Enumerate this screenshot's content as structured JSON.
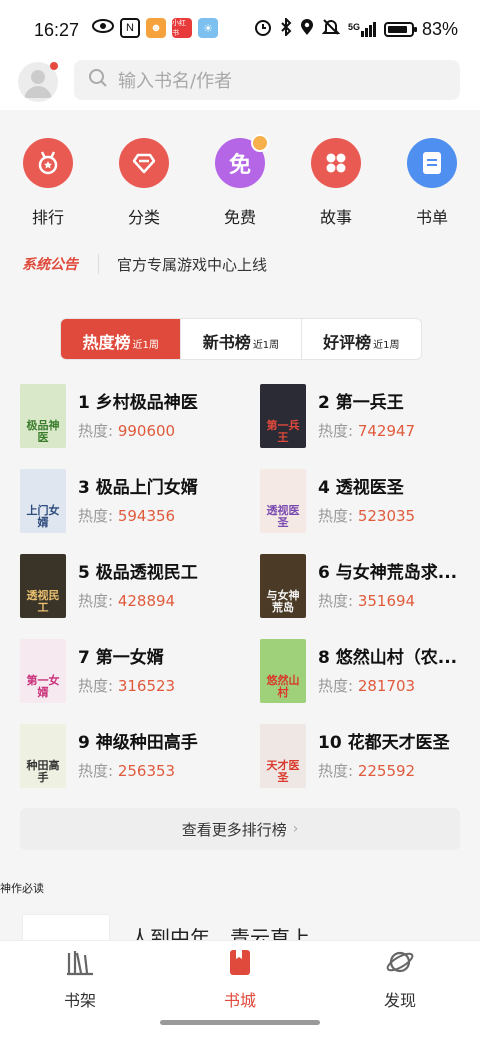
{
  "status_bar": {
    "time": "16:27",
    "left_icons": [
      "eye-icon",
      "nfc-icon",
      "app-icon-game",
      "app-icon-xiaohongshu",
      "app-icon-weather"
    ],
    "app_label": "小红书",
    "right_icons": [
      "alarm-icon",
      "bluetooth-icon",
      "location-icon",
      "mute-icon",
      "signal-5g-icon",
      "battery-icon"
    ],
    "network": "5G",
    "battery": "83%"
  },
  "header": {
    "search_placeholder": "输入书名/作者"
  },
  "categories": [
    {
      "label": "排行",
      "icon": "rank-medal-icon",
      "color": "#e95a52"
    },
    {
      "label": "分类",
      "icon": "category-diamond-icon",
      "color": "#e95a52"
    },
    {
      "label": "免费",
      "icon": "free-icon",
      "color": "#b466e6",
      "icon_text": "免"
    },
    {
      "label": "故事",
      "icon": "story-grid-icon",
      "color": "#e95a52"
    },
    {
      "label": "书单",
      "icon": "booklist-icon",
      "color": "#4f8ff0"
    }
  ],
  "notice": {
    "tag": "系统公告",
    "text": "官方专属游戏中心上线"
  },
  "tabs": [
    {
      "name": "热度榜",
      "sub": "近1周",
      "active": true
    },
    {
      "name": "新书榜",
      "sub": "近1周",
      "active": false
    },
    {
      "name": "好评榜",
      "sub": "近1周",
      "active": false
    }
  ],
  "books": [
    {
      "title": "1 乡村极品神医",
      "heat_label": "热度: ",
      "heat": "990600",
      "cover_text": "极品神医",
      "cover_bg": "#d9e8c8",
      "cover_fg": "#3a7d2c"
    },
    {
      "title": "2 第一兵王",
      "heat_label": "热度: ",
      "heat": "742947",
      "cover_text": "第一兵王",
      "cover_bg": "#2b2b35",
      "cover_fg": "#e04a3c"
    },
    {
      "title": "3 极品上门女婿",
      "heat_label": "热度: ",
      "heat": "594356",
      "cover_text": "上门女婿",
      "cover_bg": "#dfe6ef",
      "cover_fg": "#2d4a7c"
    },
    {
      "title": "4 透视医圣",
      "heat_label": "热度: ",
      "heat": "523035",
      "cover_text": "透视医圣",
      "cover_bg": "#f4e9e4",
      "cover_fg": "#7a4ab0"
    },
    {
      "title": "5 极品透视民工",
      "heat_label": "热度: ",
      "heat": "428894",
      "cover_text": "透视民工",
      "cover_bg": "#3a3327",
      "cover_fg": "#e8c070"
    },
    {
      "title": "6 与女神荒岛求...",
      "heat_label": "热度: ",
      "heat": "351694",
      "cover_text": "与女神荒岛",
      "cover_bg": "#4a3a26",
      "cover_fg": "#f5f5f5"
    },
    {
      "title": "7 第一女婿",
      "heat_label": "热度: ",
      "heat": "316523",
      "cover_text": "第一女婿",
      "cover_bg": "#f6e9ef",
      "cover_fg": "#c8307a"
    },
    {
      "title": "8 悠然山村（农...",
      "heat_label": "热度: ",
      "heat": "281703",
      "cover_text": "悠然山村",
      "cover_bg": "#9fd07a",
      "cover_fg": "#d8392c"
    },
    {
      "title": "9 神级种田高手",
      "heat_label": "热度: ",
      "heat": "256353",
      "cover_text": "种田高手",
      "cover_bg": "#eef0e2",
      "cover_fg": "#333333"
    },
    {
      "title": "10 花都天才医圣",
      "heat_label": "热度: ",
      "heat": "225592",
      "cover_text": "天才医圣",
      "cover_bg": "#efe7e3",
      "cover_fg": "#d8392c"
    }
  ],
  "more_button": "查看更多排行榜",
  "section_title": "神作必读",
  "peek_title": "人到中年，青云直上",
  "bottom_nav": [
    {
      "label": "书架",
      "icon": "bookshelf-icon",
      "active": false
    },
    {
      "label": "书城",
      "icon": "bookstore-icon",
      "active": true
    },
    {
      "label": "发现",
      "icon": "planet-icon",
      "active": false
    }
  ],
  "colors": {
    "accent": "#e04a3c",
    "heat_number": "#e05a3c"
  }
}
